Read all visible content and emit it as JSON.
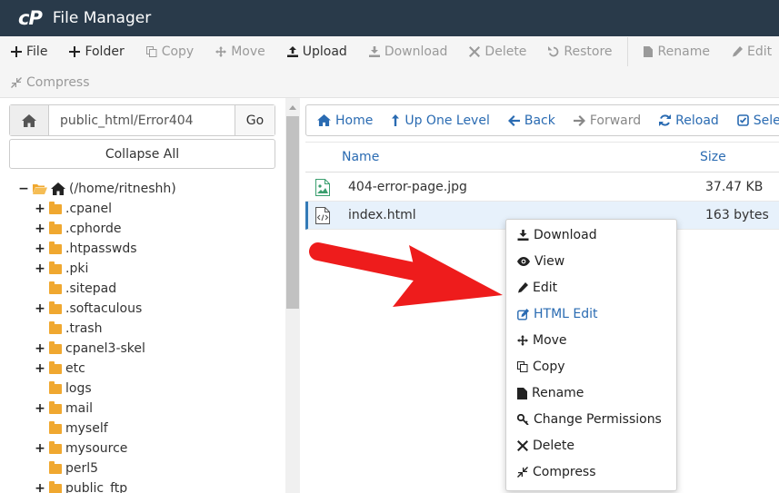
{
  "app": {
    "logo": "cP",
    "title": "File Manager"
  },
  "toolbar": {
    "row1": [
      {
        "label": "File",
        "icon": "plus-icon",
        "disabled": false
      },
      {
        "label": "Folder",
        "icon": "plus-icon",
        "disabled": false
      },
      {
        "label": "Copy",
        "icon": "copy-icon",
        "disabled": true
      },
      {
        "label": "Move",
        "icon": "move-icon",
        "disabled": true
      },
      {
        "label": "Upload",
        "icon": "upload-icon",
        "disabled": false
      },
      {
        "label": "Download",
        "icon": "download-icon",
        "disabled": true
      },
      {
        "label": "Delete",
        "icon": "x-icon",
        "disabled": true
      },
      {
        "label": "Restore",
        "icon": "undo-icon",
        "disabled": true
      },
      {
        "label": "Rename",
        "icon": "file-icon",
        "disabled": true
      },
      {
        "label": "Edit",
        "icon": "pencil-icon",
        "disabled": true
      }
    ],
    "row2": [
      {
        "label": "Compress",
        "icon": "compress-icon",
        "disabled": true
      }
    ]
  },
  "left": {
    "path_value": "public_html/Error404",
    "go_label": "Go",
    "collapse_label": "Collapse All",
    "root_label": "(/home/ritneshh)",
    "tree": [
      {
        "name": ".cpanel",
        "expandable": true
      },
      {
        "name": ".cphorde",
        "expandable": true
      },
      {
        "name": ".htpasswds",
        "expandable": true
      },
      {
        "name": ".pki",
        "expandable": true
      },
      {
        "name": ".sitepad",
        "expandable": false
      },
      {
        "name": ".softaculous",
        "expandable": true
      },
      {
        "name": ".trash",
        "expandable": false
      },
      {
        "name": "cpanel3-skel",
        "expandable": true
      },
      {
        "name": "etc",
        "expandable": true
      },
      {
        "name": "logs",
        "expandable": false
      },
      {
        "name": "mail",
        "expandable": true
      },
      {
        "name": "myself",
        "expandable": false
      },
      {
        "name": "mysource",
        "expandable": true
      },
      {
        "name": "perl5",
        "expandable": false
      },
      {
        "name": "public_ftp",
        "expandable": true
      }
    ]
  },
  "nav": {
    "home": "Home",
    "up": "Up One Level",
    "back": "Back",
    "forward": "Forward",
    "reload": "Reload",
    "select": "Sele"
  },
  "table": {
    "col_name": "Name",
    "col_size": "Size",
    "rows": [
      {
        "name": "404-error-page.jpg",
        "size": "37.47 KB",
        "icon": "image-file-icon",
        "selected": false
      },
      {
        "name": "index.html",
        "size": "163 bytes",
        "icon": "code-file-icon",
        "selected": true
      }
    ]
  },
  "context_menu": [
    {
      "label": "Download",
      "icon": "download-icon"
    },
    {
      "label": "View",
      "icon": "eye-icon"
    },
    {
      "label": "Edit",
      "icon": "pencil-icon"
    },
    {
      "label": "HTML Edit",
      "icon": "edit-square-icon",
      "highlight": true
    },
    {
      "label": "Move",
      "icon": "move-icon"
    },
    {
      "label": "Copy",
      "icon": "copy-icon"
    },
    {
      "label": "Rename",
      "icon": "file-icon"
    },
    {
      "label": "Change Permissions",
      "icon": "key-icon"
    },
    {
      "label": "Delete",
      "icon": "x-icon"
    },
    {
      "label": "Compress",
      "icon": "compress-icon"
    }
  ],
  "colors": {
    "titlebar": "#293a4a",
    "link": "#2a6bb2",
    "arrow": "#ee1c1c",
    "folder": "#f0a830"
  }
}
